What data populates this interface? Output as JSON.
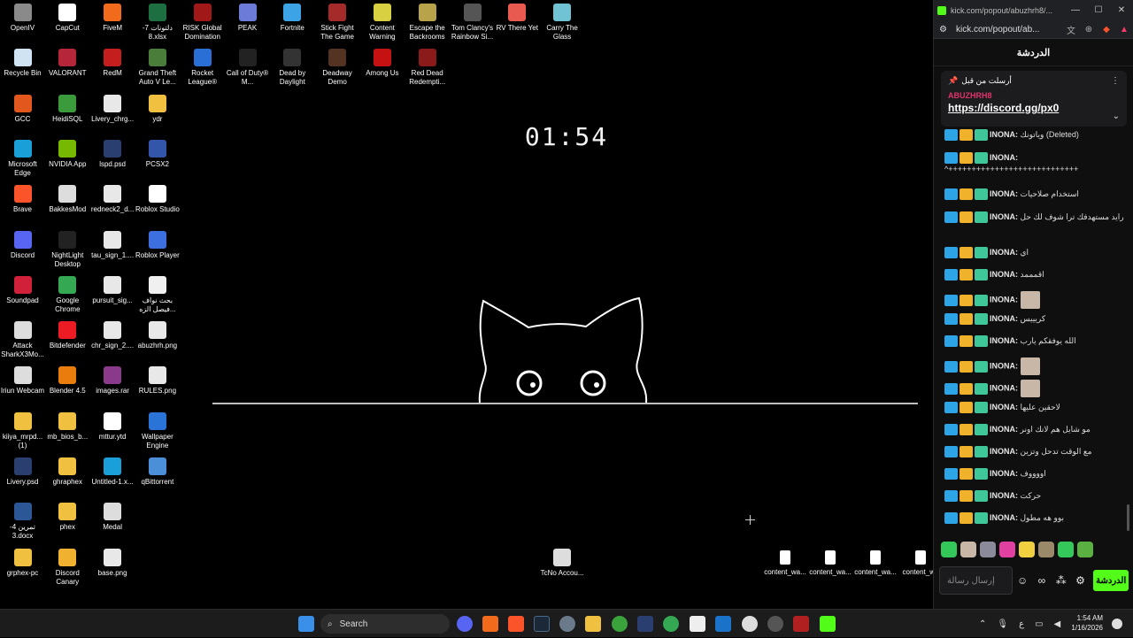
{
  "desktop": {
    "icons": [
      {
        "label": "OpenIV",
        "color": "#8a8a8a"
      },
      {
        "label": "CapCut",
        "color": "#ffffff"
      },
      {
        "label": "FiveM",
        "color": "#f26b1d"
      },
      {
        "label": "دلتونات 7-8.xlsx",
        "color": "#1d6f42"
      },
      {
        "label": "RISK Global Domination",
        "color": "#a01818"
      },
      {
        "label": "PEAK",
        "color": "#6c7bd8"
      },
      {
        "label": "Fortnite",
        "color": "#3ba3e6"
      },
      {
        "label": "Stick Fight The Game",
        "color": "#a52a2a"
      },
      {
        "label": "Content Warning",
        "color": "#d8d040"
      },
      {
        "label": "Escape the Backrooms",
        "color": "#b8a34a"
      },
      {
        "label": "Tom Clancy's Rainbow Si...",
        "color": "#555555"
      },
      {
        "label": "RV There Yet",
        "color": "#e85a4f"
      },
      {
        "label": "Carry The Glass",
        "color": "#6fc3d2"
      },
      {
        "label": "Recycle Bin",
        "color": "#cfe3f2"
      },
      {
        "label": "VALORANT",
        "color": "#b6263b"
      },
      {
        "label": "RedM",
        "color": "#c41e1e"
      },
      {
        "label": "Grand Theft Auto V Le...",
        "color": "#4a7d3a"
      },
      {
        "label": "Rocket League®",
        "color": "#2a6fd6"
      },
      {
        "label": "Call of Duty® M...",
        "color": "#222222"
      },
      {
        "label": "Dead by Daylight",
        "color": "#333333"
      },
      {
        "label": "Deadway Demo",
        "color": "#553322"
      },
      {
        "label": "Among Us",
        "color": "#c51111"
      },
      {
        "label": "Red Dead Redempti...",
        "color": "#8b1a1a"
      },
      {
        "label": "GCC",
        "color": "#e2571e"
      },
      {
        "label": "HeidiSQL",
        "color": "#3b9a3b"
      },
      {
        "label": "Livery_chrg...",
        "color": "#e8e8e8"
      },
      {
        "label": "ydr",
        "color": "#f0c040"
      },
      {
        "label": "Microsoft Edge",
        "color": "#1a9fd8"
      },
      {
        "label": "NVIDIA App",
        "color": "#76b900"
      },
      {
        "label": "lspd.psd",
        "color": "#2a3f70"
      },
      {
        "label": "PCSX2",
        "color": "#3355aa"
      },
      {
        "label": "Brave",
        "color": "#fb542b"
      },
      {
        "label": "BakkesMod",
        "color": "#dddddd"
      },
      {
        "label": "redneck2_d...",
        "color": "#e8e8e8"
      },
      {
        "label": "Roblox Studio",
        "color": "#ffffff"
      },
      {
        "label": "Discord",
        "color": "#5865f2"
      },
      {
        "label": "NightLight Desktop",
        "color": "#222222"
      },
      {
        "label": "tau_sign_1....",
        "color": "#e8e8e8"
      },
      {
        "label": "Roblox Player",
        "color": "#3e6fe0"
      },
      {
        "label": "Soundpad",
        "color": "#d0203a"
      },
      {
        "label": "Google Chrome",
        "color": "#34a853"
      },
      {
        "label": "pursuit_sig...",
        "color": "#e8e8e8"
      },
      {
        "label": "بحث نواف فيصل الزه...",
        "color": "#f0f0f0"
      },
      {
        "label": "Attack SharkX3Mo...",
        "color": "#dddddd"
      },
      {
        "label": "Bitdefender",
        "color": "#ed1c24"
      },
      {
        "label": "chr_sign_2....",
        "color": "#e8e8e8"
      },
      {
        "label": "abuzhrh.png",
        "color": "#e8e8e8"
      },
      {
        "label": "Iriun Webcam",
        "color": "#dddddd"
      },
      {
        "label": "Blender 4.5",
        "color": "#e87d0d"
      },
      {
        "label": "images.rar",
        "color": "#8b3a8b"
      },
      {
        "label": "RULES.png",
        "color": "#e8e8e8"
      },
      {
        "label": "kiiya_mrpd... (1)",
        "color": "#f0c040"
      },
      {
        "label": "mb_bios_b...",
        "color": "#f0c040"
      },
      {
        "label": "mttur.ytd",
        "color": "#ffffff"
      },
      {
        "label": "Wallpaper Engine",
        "color": "#2a74d8"
      },
      {
        "label": "Livery.psd",
        "color": "#2a3f70"
      },
      {
        "label": "ghraphex",
        "color": "#f0c040"
      },
      {
        "label": "Untitled-1.x...",
        "color": "#1a9fd8"
      },
      {
        "label": "qBittorrent",
        "color": "#4a8fd8"
      },
      {
        "label": "تمرين 4-3.docx",
        "color": "#2b5797"
      },
      {
        "label": "phex",
        "color": "#f0c040"
      },
      {
        "label": "Medal",
        "color": "#dddddd"
      },
      {
        "label": "grphex-pc",
        "color": "#f0c040"
      },
      {
        "label": "Discord Canary",
        "color": "#f0b030"
      },
      {
        "label": "base.png",
        "color": "#e8e8e8"
      },
      {
        "label": "TcNo Accou...",
        "color": "#dddddd"
      }
    ],
    "files": [
      "content_wa...",
      "content_wa...",
      "content_wa...",
      "content_wa"
    ],
    "clock": "01:54"
  },
  "chat": {
    "window_title": "kick.com/popout/abuzhrh8/...",
    "url": "kick.com/popout/ab...",
    "header": "الدردشة",
    "pinned": {
      "label": "أرسلت من قبل",
      "user": "ABUZHRH8",
      "link": "https://discord.gg/px0"
    },
    "messages": [
      {
        "user": "INONA:",
        "text": "وياتونك (Deleted)",
        "emote": false
      },
      {
        "user": "INONA:",
        "text": "^++++++++++++++++++++++++++++",
        "emote": false
      },
      {
        "user": "INONA:",
        "text": "استخدام صلاحيات",
        "emote": false
      },
      {
        "user": "INONA:",
        "text": "رايد مستهدفك ترا شوف لك حل",
        "emote": false
      },
      {
        "user": "INONA:",
        "text": "اي",
        "emote": false
      },
      {
        "user": "INONA:",
        "text": "اقمممد",
        "emote": false
      },
      {
        "user": "INONA:",
        "text": "",
        "emote": true
      },
      {
        "user": "INONA:",
        "text": "كريييس",
        "emote": false
      },
      {
        "user": "INONA:",
        "text": "الله يوفقكم يارب",
        "emote": false
      },
      {
        "user": "INONA:",
        "text": "",
        "emote": true
      },
      {
        "user": "INONA:",
        "text": "",
        "emote": true
      },
      {
        "user": "INONA:",
        "text": "لاحقين عليها",
        "emote": false
      },
      {
        "user": "INONA:",
        "text": "مو شايل هم لانك اونر",
        "emote": false
      },
      {
        "user": "INONA:",
        "text": "مع الوقت تدحل وتزين",
        "emote": false
      },
      {
        "user": "INONA:",
        "text": "اووووف",
        "emote": false
      },
      {
        "user": "INONA:",
        "text": "حركت",
        "emote": false
      },
      {
        "user": "INONA:",
        "text": "بوو هه مطول",
        "emote": false
      }
    ],
    "composer_placeholder": "إرسال رسالة",
    "send_label": "الدردشة"
  },
  "taskbar": {
    "search": "Search",
    "time": "1:54 AM",
    "date": "1/16/2026",
    "lang": "ع"
  }
}
